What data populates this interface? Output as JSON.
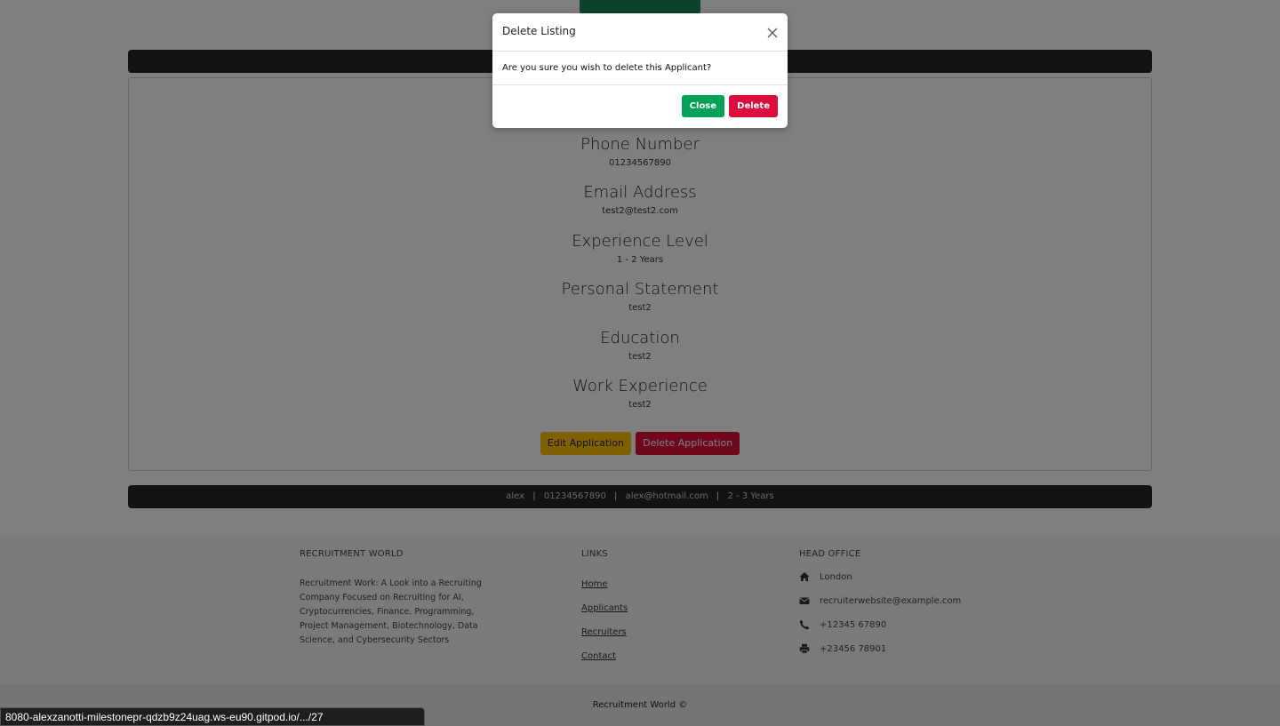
{
  "applicant": {
    "fields": [
      {
        "label": "Phone Number",
        "value": "01234567890"
      },
      {
        "label": "Email Address",
        "value": "test2@test2.com"
      },
      {
        "label": "Experience Level",
        "value": "1 - 2 Years"
      },
      {
        "label": "Personal Statement",
        "value": "test2"
      },
      {
        "label": "Education",
        "value": "test2"
      },
      {
        "label": "Work Experience",
        "value": "test2"
      }
    ],
    "edit_label": "Edit Application",
    "delete_label": "Delete Application"
  },
  "info_bar": {
    "name": "alex",
    "phone": "01234567890",
    "email": "alex@hotmail.com",
    "experience": "2 - 3 Years",
    "separator": "|"
  },
  "footer": {
    "about_title": "RECRUITMENT WORLD",
    "about_text": "Recruitment Work: A Look into a Recruiting Company Focused on Recruiting for AI, Cryptocurrencies, Finance, Programming, Project Management, Biotechnology, Data Science, and Cybersecurity Sectors",
    "links_title": "LINKS",
    "links": [
      "Home",
      "Applicants",
      "Recruiters",
      "Contact"
    ],
    "office_title": "HEAD OFFICE",
    "office": [
      {
        "icon": "home-icon",
        "text": "London"
      },
      {
        "icon": "envelope-icon",
        "text": "recruiterwebsite@example.com"
      },
      {
        "icon": "phone-icon",
        "text": "+12345 67890"
      },
      {
        "icon": "print-icon",
        "text": "+23456 78901"
      }
    ],
    "copyright": "Recruitment World ©"
  },
  "modal": {
    "title": "Delete Listing",
    "body": "Are you sure you wish to delete this Applicant?",
    "close_label": "Close",
    "delete_label": "Delete"
  },
  "status_url": "8080-alexzanotti-milestonepr-qdzb9z24uag.ws-eu90.gitpod.io/.../27",
  "colors": {
    "dark": "#212529",
    "warning": "#ffc107",
    "danger": "#dc0c3c",
    "success": "#00a255"
  }
}
